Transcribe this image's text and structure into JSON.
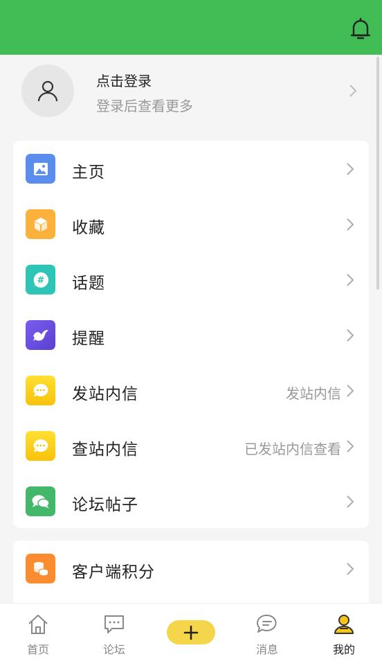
{
  "header": {
    "bell_icon": "bell-icon",
    "accent": "#42bd56"
  },
  "profile": {
    "name": "点击登录",
    "subtitle": "登录后查看更多",
    "avatar_icon": "user-icon"
  },
  "menu": [
    {
      "label": "主页",
      "extra": "",
      "icon": "image-icon",
      "color": "#5b8def"
    },
    {
      "label": "收藏",
      "extra": "",
      "icon": "box-icon",
      "color": "#fbb13c"
    },
    {
      "label": "话题",
      "extra": "",
      "icon": "hashtag-chat-icon",
      "color": "#2ec4b6"
    },
    {
      "label": "提醒",
      "extra": "",
      "icon": "bird-icon",
      "color": "#6c4fe0"
    },
    {
      "label": "发站内信",
      "extra": "发站内信",
      "icon": "message-bubble-icon",
      "color": "#fcd21c"
    },
    {
      "label": "查站内信",
      "extra": "已发站内信查看",
      "icon": "message-bubble-icon",
      "color": "#fcd21c"
    },
    {
      "label": "论坛帖子",
      "extra": "",
      "icon": "chat-bubbles-icon",
      "color": "#43b86a"
    }
  ],
  "menu2": [
    {
      "label": "客户端积分",
      "extra": "",
      "icon": "coins-icon",
      "color": "#fb8c2f"
    }
  ],
  "tabbar": {
    "tabs": [
      {
        "label": "首页",
        "icon": "home-icon"
      },
      {
        "label": "论坛",
        "icon": "forum-icon"
      },
      {
        "label": "消息",
        "icon": "message-icon"
      },
      {
        "label": "我的",
        "icon": "me-icon"
      }
    ],
    "plus_icon": "plus-icon",
    "plus_color": "#f5d549"
  }
}
